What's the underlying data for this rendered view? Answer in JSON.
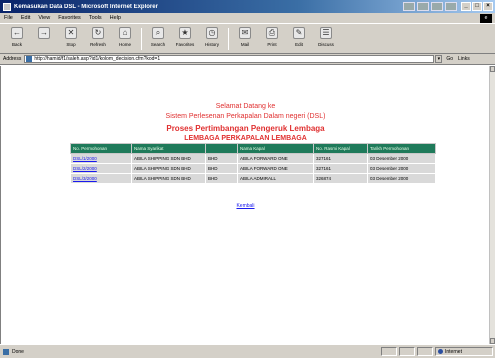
{
  "window": {
    "title": "Kemasukan Data DSL - Microsoft Internet Explorer",
    "controls": [
      "_",
      "□",
      "×"
    ]
  },
  "menu": [
    "File",
    "Edit",
    "View",
    "Favorites",
    "Tools",
    "Help"
  ],
  "toolbar": [
    {
      "label": "Back",
      "icon": "back-arrow-icon",
      "glyph": "←"
    },
    {
      "label": "",
      "icon": "forward-arrow-icon",
      "glyph": "→"
    },
    {
      "label": "Stop",
      "icon": "stop-icon",
      "glyph": "✕"
    },
    {
      "label": "Refresh",
      "icon": "refresh-icon",
      "glyph": "↻"
    },
    {
      "label": "Home",
      "icon": "home-icon",
      "glyph": "⌂"
    },
    {
      "label": "Search",
      "icon": "search-icon",
      "glyph": "⌕"
    },
    {
      "label": "Favorites",
      "icon": "favorites-icon",
      "glyph": "★"
    },
    {
      "label": "History",
      "icon": "history-icon",
      "glyph": "◷"
    },
    {
      "label": "Mail",
      "icon": "mail-icon",
      "glyph": "✉"
    },
    {
      "label": "Print",
      "icon": "print-icon",
      "glyph": "⎙"
    },
    {
      "label": "Edit",
      "icon": "edit-icon",
      "glyph": "✎"
    },
    {
      "label": "Discuss",
      "icon": "discuss-icon",
      "glyph": "☰"
    }
  ],
  "address": {
    "label": "Address",
    "url": "http://hamid/f1/saleh.asp?id1/kolom_decision.cfm?kod=1",
    "go": "Go",
    "links": "Links"
  },
  "page": {
    "line1": "Selamat Datang ke",
    "line2": "Sistem Perlesenan Perkapalan Dalam negeri (DSL)",
    "line3": "Proses Pertimbangan Pengeruk Lembaga",
    "line4": "LEMBAGA PERKAPALAN LEMBAGA",
    "back_link": "Kembali"
  },
  "table": {
    "headers": [
      "No. Permohonan",
      "Nama Syarikat",
      "",
      "Nama Kapal",
      "No. Rasmi Kapal",
      "Tarikh Permohonan"
    ],
    "rows": [
      [
        "DSL/1/2000",
        "ABILA SHIPPING SDN BHD",
        "BHD",
        "ABILA FORWARD ONE",
        "327161",
        "03 Desember 2000"
      ],
      [
        "DSL/2/2000",
        "ABILA SHIPPING SDN BHD",
        "BHD",
        "ABILA FORWARD ONE",
        "327161",
        "03 Desember 2000"
      ],
      [
        "DSL/3/2000",
        "ABILA SHIPPING SDN BHD",
        "BHD",
        "ABILA ADMIRALL",
        "326874",
        "03 Desember 2000"
      ]
    ]
  },
  "status": {
    "text": "Done",
    "zone": "Internet"
  }
}
